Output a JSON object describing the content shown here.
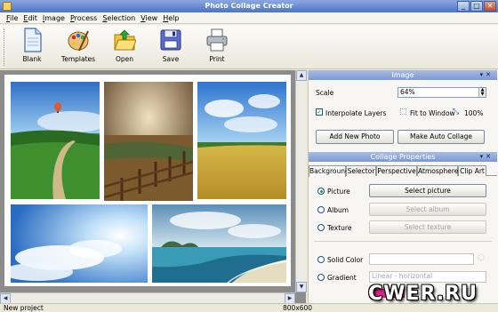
{
  "window": {
    "title": "Photo Collage Creator",
    "controls": [
      "_",
      "□",
      "✕"
    ]
  },
  "menu": [
    {
      "underline": "F",
      "rest": "ile"
    },
    {
      "underline": "E",
      "rest": "dit"
    },
    {
      "underline": "I",
      "rest": "mage"
    },
    {
      "underline": "P",
      "rest": "rocess"
    },
    {
      "underline": "S",
      "rest": "election"
    },
    {
      "underline": "V",
      "rest": "iew"
    },
    {
      "underline": "H",
      "rest": "elp"
    }
  ],
  "toolbar": {
    "blank": "Blank",
    "templates": "Templates",
    "open": "Open",
    "save": "Save",
    "print": "Print"
  },
  "image_panel": {
    "title": "Image",
    "scale_label": "Scale",
    "scale_value": "64%",
    "interpolate_label": "Interpolate Layers",
    "interpolate_checked": true,
    "fit_to_window": "Fit to Window",
    "zoom_100": "100%",
    "add_new_photo": "Add New Photo",
    "make_auto_collage": "Make Auto Collage"
  },
  "props_panel": {
    "title": "Collage Properties",
    "tabs": [
      "Background",
      "Selector",
      "Perspective",
      "Atmosphere",
      "Clip Art"
    ],
    "active_tab": "Background",
    "picture_label": "Picture",
    "select_picture": "Select picture",
    "album_label": "Album",
    "select_album": "Select album",
    "texture_label": "Texture",
    "select_texture": "Select texture",
    "solid_color_label": "Solid Color",
    "gradient_label": "Gradient",
    "gradient_value": "Linear - horizontal",
    "gradient_color": "#e0208a"
  },
  "status": {
    "left": "New project",
    "right": "800x600"
  },
  "watermark": "CWER.RU"
}
